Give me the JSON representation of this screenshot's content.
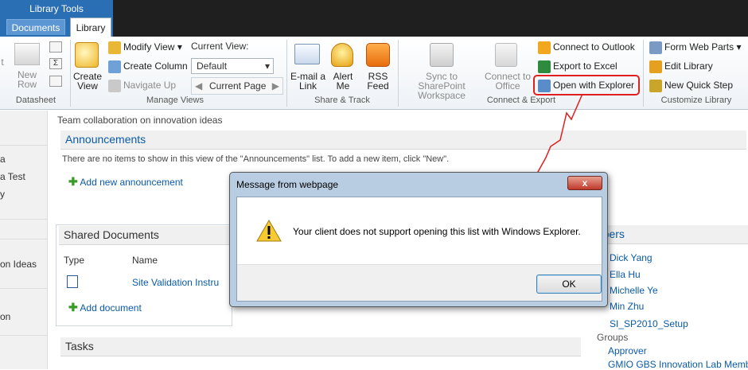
{
  "ribbon_context": {
    "title": "Library Tools"
  },
  "tabs": [
    {
      "label": "Documents"
    },
    {
      "label": "Library"
    }
  ],
  "ribbon": {
    "datasheet": {
      "label": "Datasheet",
      "partial_left": "t",
      "new_row": "New\nRow"
    },
    "manage_views": {
      "label": "Manage Views",
      "create_view": "Create\nView",
      "modify_view": "Modify View",
      "create_column": "Create Column",
      "navigate_up": "Navigate Up",
      "current_view_label": "Current View:",
      "current_view_value": "Default",
      "current_page": "Current Page"
    },
    "share_track": {
      "label": "Share & Track",
      "email_link": "E-mail a\nLink",
      "alert_me": "Alert\nMe",
      "rss_feed": "RSS\nFeed"
    },
    "connect_export": {
      "label": "Connect & Export",
      "sync": "Sync to SharePoint\nWorkspace",
      "connect_office": "Connect to\nOffice",
      "connect_outlook": "Connect to Outlook",
      "export_excel": "Export to Excel",
      "open_explorer": "Open with Explorer"
    },
    "customize_library": {
      "label": "Customize Library",
      "form_web_parts": "Form Web Parts",
      "edit_library": "Edit Library",
      "new_quick_step": "New Quick Step"
    }
  },
  "leftnav": {
    "items": [
      "a",
      "a Test",
      "y",
      "on Ideas",
      "on"
    ]
  },
  "page": {
    "description": "Team collaboration on innovation ideas"
  },
  "announcements": {
    "title": "Announcements",
    "empty": "There are no items to show in this view of the \"Announcements\" list. To add a new item, click \"New\".",
    "add": "Add new announcement"
  },
  "shared_documents": {
    "title": "Shared Documents",
    "col_type": "Type",
    "col_name": "Name",
    "row_name": "Site Validation Instru",
    "add": "Add document"
  },
  "tasks": {
    "title": "Tasks"
  },
  "members": {
    "title": "mbers",
    "people": [
      "Dick Yang",
      "Ella Hu",
      "Michelle Ye",
      "Min Zhu",
      "SI_SP2010_Setup"
    ],
    "groups_label": "Groups",
    "groups": [
      "Approver",
      "GMIO GBS Innovation Lab Members"
    ]
  },
  "dialog": {
    "title": "Message from webpage",
    "message": "Your client does not support opening this list with Windows Explorer.",
    "ok": "OK",
    "close": "x"
  },
  "colors": {
    "accent": "#0a5aa8",
    "highlight": "#e02020",
    "ribbon_tab": "#2a6fb4"
  }
}
